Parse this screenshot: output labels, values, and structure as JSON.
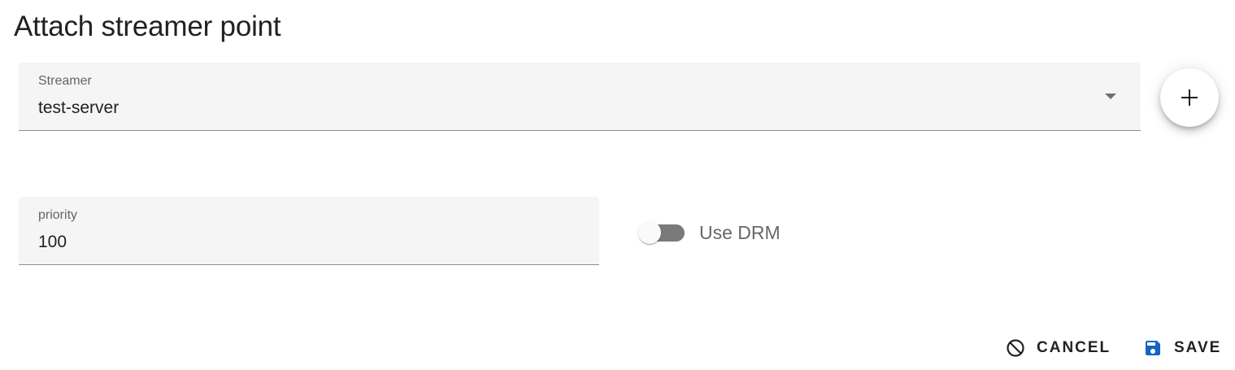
{
  "dialog": {
    "title": "Attach streamer point"
  },
  "streamer_field": {
    "label": "Streamer",
    "value": "test-server"
  },
  "add_button": {
    "icon": "plus-icon"
  },
  "priority_field": {
    "label": "priority",
    "value": "100"
  },
  "drm_toggle": {
    "label": "Use DRM",
    "checked": false
  },
  "actions": {
    "cancel_label": "CANCEL",
    "cancel_icon": "cancel-icon",
    "save_label": "SAVE",
    "save_icon": "save-icon"
  },
  "colors": {
    "field_background": "#f5f5f5",
    "save_icon": "#1565c0",
    "toggle_track": "#7a7a7a"
  }
}
